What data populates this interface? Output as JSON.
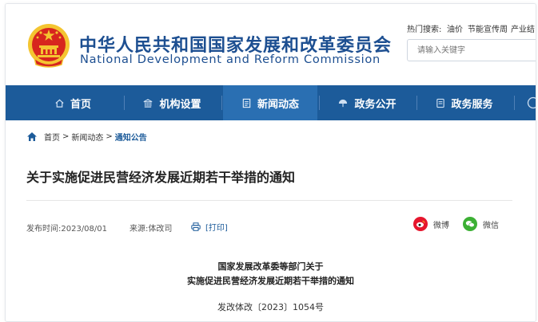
{
  "header": {
    "title_cn": "中华人民共和国国家发展和改革委员会",
    "title_en": "National Development and Reform Commission",
    "hot_search_label": "热门搜索:",
    "hot_links": [
      "油价",
      "节能宣传周",
      "产业结"
    ],
    "search_placeholder": "请输入关键字"
  },
  "nav": {
    "items": [
      {
        "label": "首页",
        "icon": "home-icon"
      },
      {
        "label": "机构设置",
        "icon": "building-icon"
      },
      {
        "label": "新闻动态",
        "icon": "news-icon"
      },
      {
        "label": "政务公开",
        "icon": "umbrella-icon"
      },
      {
        "label": "政务服务",
        "icon": "document-icon"
      }
    ],
    "active_index": 2
  },
  "breadcrumb": {
    "items": [
      "首页",
      "新闻动态",
      "通知公告"
    ],
    "separator": ">"
  },
  "article": {
    "title": "关于实施促进民营经济发展近期若干举措的通知",
    "publish_time": "发布时间:2023/08/01",
    "source": "来源:体改司",
    "print_label": "[打印]",
    "share": [
      {
        "label": "微博",
        "icon": "weibo-icon",
        "color": "#e6162d"
      },
      {
        "label": "微信",
        "icon": "wechat-icon",
        "color": "#3cb034"
      }
    ],
    "doc_heading_line1": "国家发展改革委等部门关于",
    "doc_heading_line2": "实施促进民营经济发展近期若干举措的通知",
    "doc_number": "发改体改〔2023〕1054号"
  },
  "colors": {
    "brand": "#1d4f91",
    "nav_bg": "#1c5b9a",
    "nav_active": "#2a6fb2",
    "emblem_red": "#d7261e",
    "emblem_gold": "#f4c531"
  }
}
